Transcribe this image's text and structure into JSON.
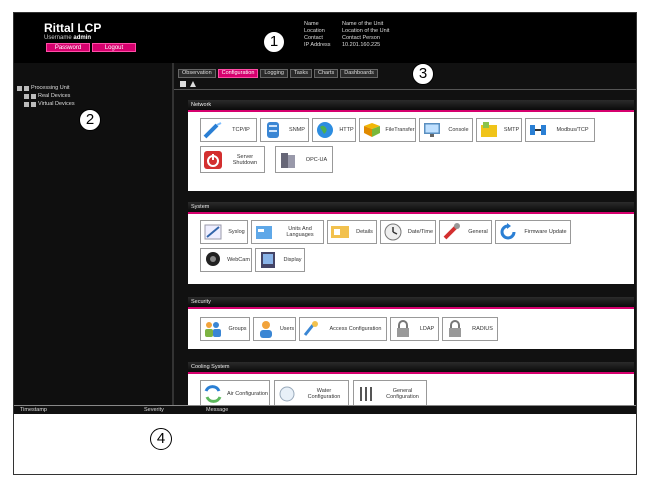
{
  "header": {
    "app_title": "Rittal LCP",
    "username_label": "Username",
    "username_value": "admin",
    "password_button": "Password",
    "logout_button": "Logout",
    "info": [
      {
        "key": "Name",
        "value": "Name of the Unit"
      },
      {
        "key": "Location",
        "value": "Location of the Unit"
      },
      {
        "key": "Contact",
        "value": "Contact Person"
      },
      {
        "key": "IP Address",
        "value": "10.201.160.225"
      }
    ]
  },
  "callouts": [
    "1",
    "2",
    "3",
    "4"
  ],
  "tree": {
    "root": "Processing Unit",
    "children": [
      "Real Devices",
      "Virtual Devices"
    ]
  },
  "tabs": [
    "Observation",
    "Configuration",
    "Logging",
    "Tasks",
    "Charts",
    "Dashboards"
  ],
  "active_tab": "Configuration",
  "sections": {
    "network": {
      "title": "Network",
      "items": [
        "TCP/IP",
        "SNMP",
        "HTTP",
        "FileTransfer",
        "Console",
        "SMTP",
        "Modbus/TCP",
        "Server Shutdown",
        "OPC-UA"
      ]
    },
    "system": {
      "title": "System",
      "items": [
        "Syslog",
        "Units And Languages",
        "Details",
        "Date/Time",
        "General",
        "Firmware Update",
        "WebCam",
        "Display"
      ]
    },
    "security": {
      "title": "Security",
      "items": [
        "Groups",
        "Users",
        "Access Configuration",
        "LDAP",
        "RADIUS"
      ]
    },
    "cooling": {
      "title": "Cooling System",
      "items": [
        "Air Configuration",
        "Water Configuration",
        "General Configuration"
      ]
    }
  },
  "log": {
    "columns": [
      "Timestamp",
      "Severity",
      "Message"
    ]
  },
  "colors": {
    "accent": "#d6006e",
    "background": "#000000"
  }
}
